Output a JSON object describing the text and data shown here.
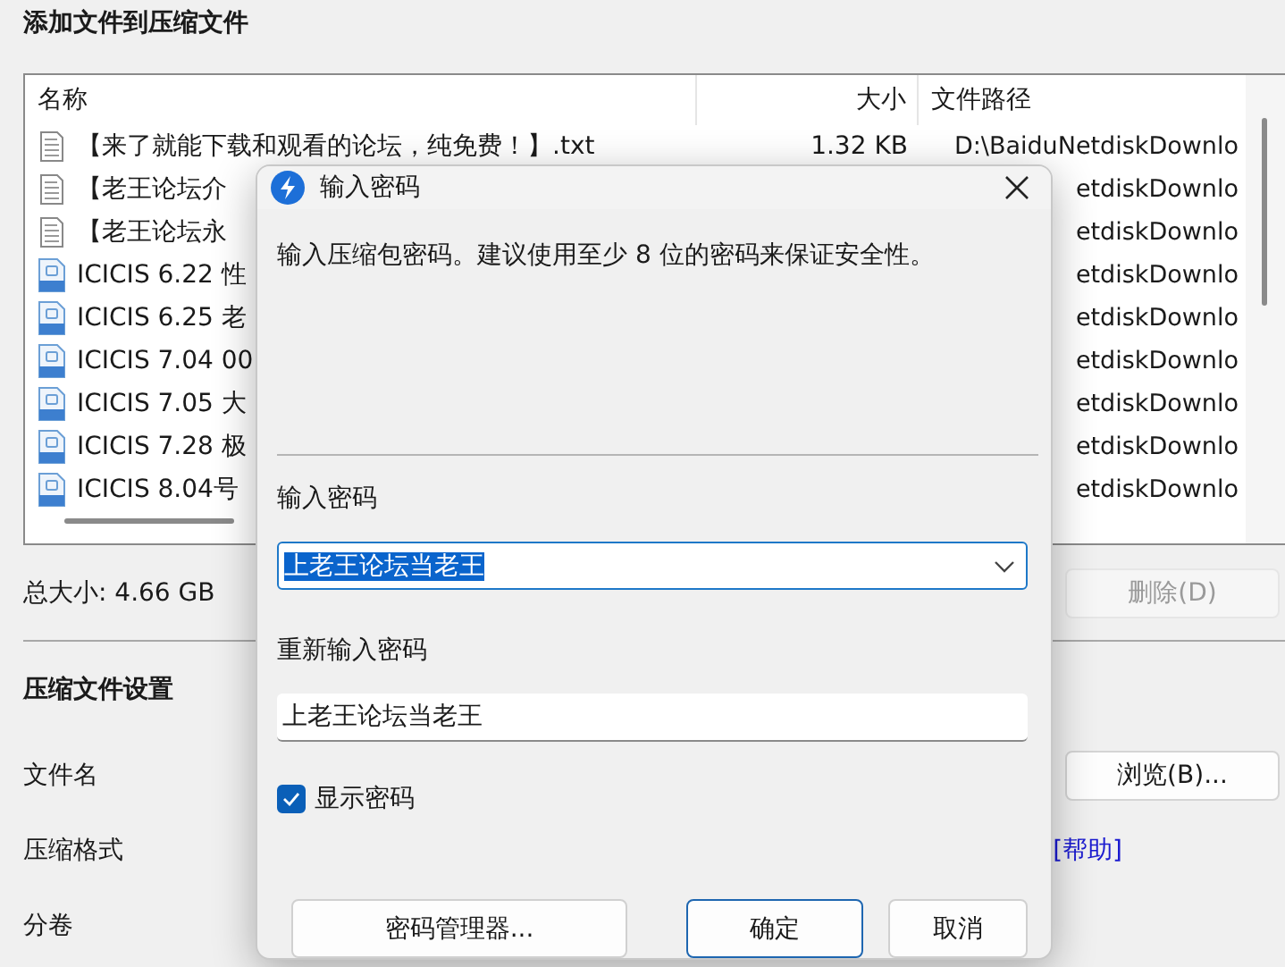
{
  "window": {
    "title": "添加文件到压缩文件"
  },
  "file_list": {
    "columns": [
      {
        "label": "名称"
      },
      {
        "label": "大小"
      },
      {
        "label": "文件路径"
      }
    ],
    "rows": [
      {
        "kind": "text",
        "name": "【来了就能下载和观看的论坛，纯免费！】.txt",
        "size": "1.32 KB",
        "path": "D:\\BaiduNetdiskDownlo"
      },
      {
        "kind": "text",
        "name": "【老王论坛介",
        "path": "etdiskDownlo"
      },
      {
        "kind": "text",
        "name": "【老王论坛永",
        "path": "etdiskDownlo"
      },
      {
        "kind": "video",
        "name": "ICICIS 6.22 性",
        "path": "etdiskDownlo"
      },
      {
        "kind": "video",
        "name": "ICICIS 6.25 老",
        "path": "etdiskDownlo"
      },
      {
        "kind": "video",
        "name": "ICICIS 7.04 00",
        "path": "etdiskDownlo"
      },
      {
        "kind": "video",
        "name": "ICICIS 7.05 大",
        "path": "etdiskDownlo"
      },
      {
        "kind": "video",
        "name": "ICICIS 7.28 极",
        "path": "etdiskDownlo"
      },
      {
        "kind": "video",
        "name": "ICICIS 8.04号",
        "path": "etdiskDownlo"
      }
    ]
  },
  "total_size": "总大小: 4.66 GB",
  "delete_button": {
    "label": "删除(D)",
    "disabled": true
  },
  "settings": {
    "title": "压缩文件设置",
    "labels": [
      "文件名",
      "压缩格式",
      "分卷"
    ],
    "browse_button": "浏览(B)...",
    "help_link": "[帮助]"
  },
  "dialog": {
    "title": "输入密码",
    "message": "输入压缩包密码。建议使用至少 8 位的密码来保证安全性。",
    "password_label": "输入密码",
    "password": {
      "value": "上老王论坛当老王",
      "text_selected": true
    },
    "repeat_label": "重新输入密码",
    "repeat_password": {
      "value": "上老王论坛当老王"
    },
    "show_password": {
      "label": "显示密码",
      "checked": true
    },
    "buttons": [
      {
        "label": "密码管理器...",
        "default": false
      },
      {
        "label": "确定",
        "default": true
      },
      {
        "label": "取消",
        "default": false
      }
    ]
  }
}
